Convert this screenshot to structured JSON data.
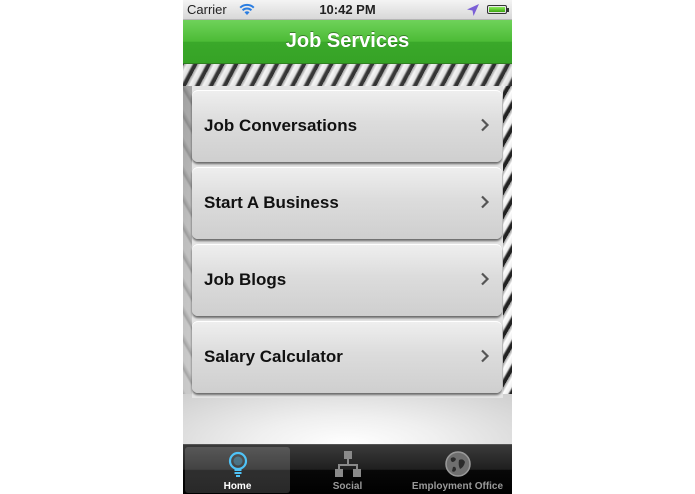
{
  "status_bar": {
    "carrier": "Carrier",
    "time": "10:42 PM"
  },
  "nav_bar": {
    "title": "Job Services"
  },
  "menu": {
    "items": [
      {
        "label": "Job Conversations"
      },
      {
        "label": "Start A Business"
      },
      {
        "label": "Job Blogs"
      },
      {
        "label": "Salary Calculator"
      }
    ]
  },
  "tab_bar": {
    "tabs": [
      {
        "label": "Home",
        "icon": "lightbulb-icon",
        "selected": true
      },
      {
        "label": "Social",
        "icon": "network-icon",
        "selected": false
      },
      {
        "label": "Employment Office",
        "icon": "globe-icon",
        "selected": false
      }
    ]
  },
  "colors": {
    "nav_green": "#4cbb36",
    "tab_bar_dark": "#111111",
    "home_icon_blue": "#4fc3f7"
  }
}
